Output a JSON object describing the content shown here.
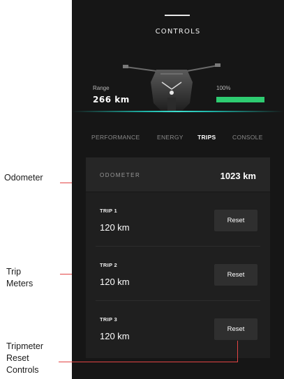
{
  "screen": {
    "title": "CONTROLS"
  },
  "status": {
    "range_label": "Range",
    "range_value": "266 km",
    "battery_label": "100%",
    "battery_level": 1.0,
    "battery_color": "#2ecc71"
  },
  "tabs": [
    {
      "label": "PERFORMANCE",
      "active": false
    },
    {
      "label": "ENERGY",
      "active": false
    },
    {
      "label": "TRIPS",
      "active": true
    },
    {
      "label": "CONSOLE",
      "active": false
    }
  ],
  "odometer": {
    "label": "ODOMETER",
    "value": "1023 km"
  },
  "trips": [
    {
      "label": "TRIP 1",
      "value": "120 km",
      "reset_label": "Reset"
    },
    {
      "label": "TRIP 2",
      "value": "120 km",
      "reset_label": "Reset"
    },
    {
      "label": "TRIP 3",
      "value": "120 km",
      "reset_label": "Reset"
    }
  ],
  "annotations": {
    "odometer": "Odometer",
    "trip_meters_1": "Trip",
    "trip_meters_2": "Meters",
    "reset_1": "Tripmeter",
    "reset_2": "Reset",
    "reset_3": "Controls",
    "line_color": "#e34444"
  },
  "icons": {
    "vehicle": "motorcycle-front-image"
  }
}
